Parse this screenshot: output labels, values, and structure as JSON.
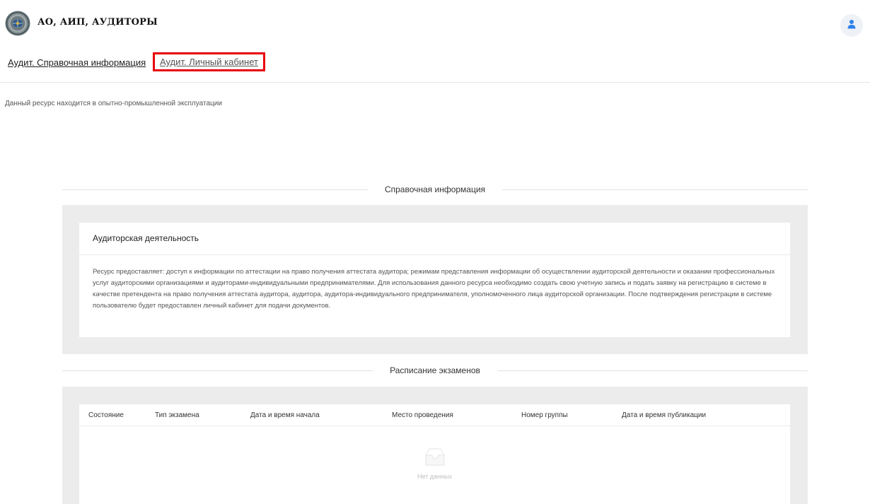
{
  "header": {
    "brand": "АО, АИП, АУДИТОРЫ",
    "logo_icon": "emblem-icon",
    "user_icon": "user-icon"
  },
  "nav": {
    "items": [
      {
        "label": "Аудит. Справочная информация"
      },
      {
        "label": "Аудит. Личный кабинет"
      }
    ]
  },
  "notice": "Данный ресурс находится в опытно-промышленной эксплуатации",
  "reference": {
    "section_title": "Справочная информация",
    "card_title": "Аудиторская деятельность",
    "card_text": "Ресурс предоставляет: доступ к информации по аттестации на право получения аттестата аудитора; режимам представления информации об осуществлении аудиторской деятельности и оказании профессиональных услуг аудиторскими организациями и аудиторами-индивидуальными предпринимателями. Для использования данного ресурса необходимо создать свою учетную запись и подать заявку на регистрацию в системе в качестве претендента на право получения аттестата аудитора, аудитора, аудитора-индивидуального предпринимателя, уполномоченного лица аудиторской организации. После подтверждения регистрации в системе пользователю будет предоставлен личный кабинет для подачи документов."
  },
  "schedule": {
    "section_title": "Расписание экзаменов",
    "columns": [
      "Состояние",
      "Тип экзамена",
      "Дата и время начала",
      "Место проведения",
      "Номер группы",
      "Дата и время публикации"
    ],
    "empty_text": "Нет данных",
    "empty_icon": "inbox-icon"
  },
  "colors": {
    "highlight": "#e8000b",
    "panel": "#ececec",
    "user_icon": "#2f80ed"
  }
}
